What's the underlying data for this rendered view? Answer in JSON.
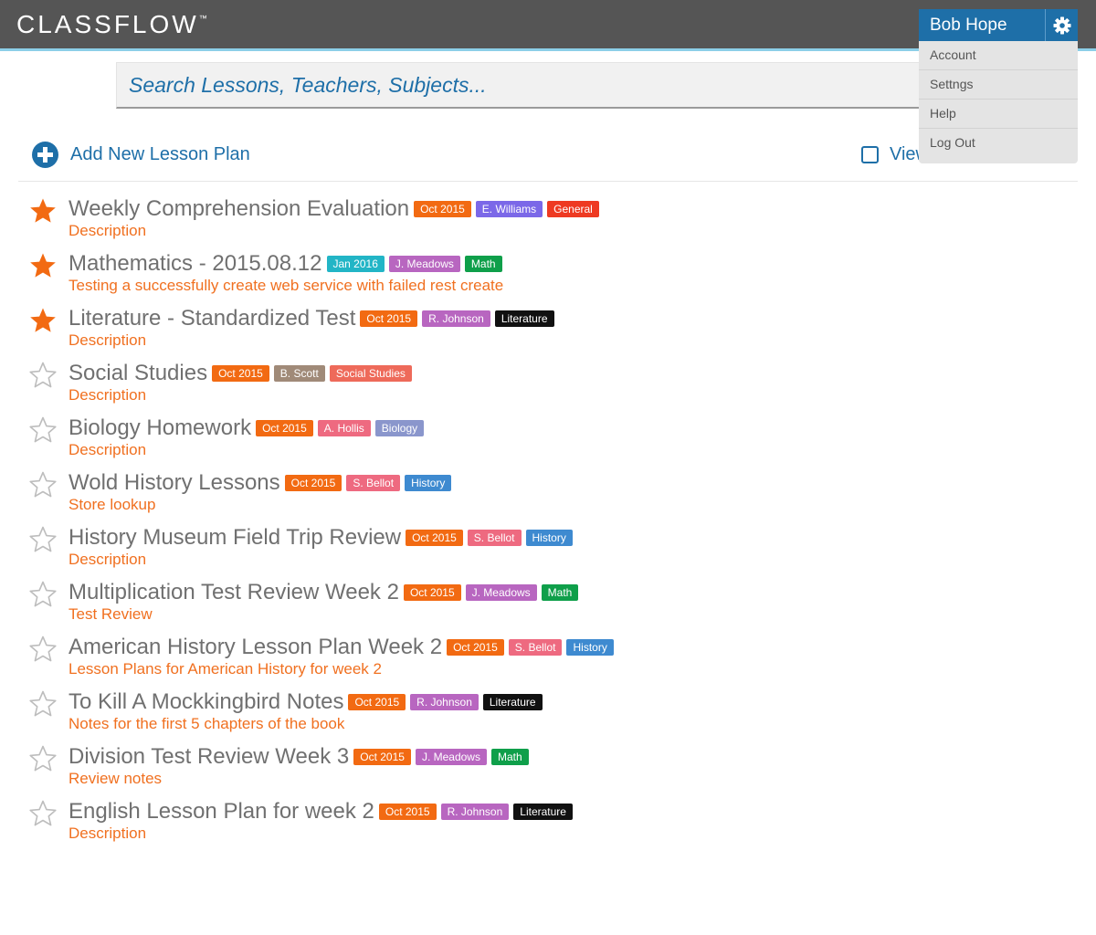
{
  "app": {
    "logo": "CLASSFLOW",
    "logo_mark": "™"
  },
  "user_menu": {
    "name": "Bob Hope",
    "items": [
      "Account",
      "Settngs",
      "Help",
      "Log Out"
    ]
  },
  "search": {
    "placeholder": "Search Lessons, Teachers, Subjects..."
  },
  "toolbar": {
    "add_label": "Add New Lesson Plan",
    "view_label": "View"
  },
  "colors": {
    "brand_blue": "#1e6fa8",
    "star_active": "#f26a12",
    "date_tag": "#f26a12",
    "date_tag_jan": "#22b5c6",
    "teacher_williams": "#7b68e8",
    "teacher_meadows": "#b866c0",
    "teacher_johnson": "#b866c0",
    "teacher_scott": "#a08a78",
    "teacher_hollis": "#ee6a80",
    "teacher_bellot": "#ee6a80",
    "subject_general": "#ee3a22",
    "subject_math": "#0f9f4a",
    "subject_literature": "#111111",
    "subject_social": "#ee6a5a",
    "subject_biology": "#8a96cc",
    "subject_history": "#3e8ad0"
  },
  "lessons": [
    {
      "title": "Weekly Comprehension Evaluation",
      "description": "Description",
      "starred": true,
      "tags": [
        {
          "text": "Oct 2015",
          "color": "#f26a12"
        },
        {
          "text": "E. Williams",
          "color": "#7b68e8"
        },
        {
          "text": "General",
          "color": "#ee3a22"
        }
      ]
    },
    {
      "title": "Mathematics - 2015.08.12",
      "description": "Testing a successfully create web service with failed rest create",
      "starred": true,
      "tags": [
        {
          "text": "Jan 2016",
          "color": "#22b5c6"
        },
        {
          "text": "J. Meadows",
          "color": "#b866c0"
        },
        {
          "text": "Math",
          "color": "#0f9f4a"
        }
      ]
    },
    {
      "title": "Literature - Standardized Test",
      "description": "Description",
      "starred": true,
      "tags": [
        {
          "text": "Oct 2015",
          "color": "#f26a12"
        },
        {
          "text": "R. Johnson",
          "color": "#b866c0"
        },
        {
          "text": "Literature",
          "color": "#111111"
        }
      ]
    },
    {
      "title": "Social Studies",
      "description": "Description",
      "starred": false,
      "tags": [
        {
          "text": "Oct 2015",
          "color": "#f26a12"
        },
        {
          "text": "B. Scott",
          "color": "#a08a78"
        },
        {
          "text": "Social Studies",
          "color": "#ee6a5a"
        }
      ]
    },
    {
      "title": "Biology Homework",
      "description": "Description",
      "starred": false,
      "tags": [
        {
          "text": "Oct 2015",
          "color": "#f26a12"
        },
        {
          "text": "A. Hollis",
          "color": "#ee6a80"
        },
        {
          "text": "Biology",
          "color": "#8a96cc"
        }
      ]
    },
    {
      "title": "Wold History Lessons",
      "description": "Store lookup",
      "starred": false,
      "tags": [
        {
          "text": "Oct 2015",
          "color": "#f26a12"
        },
        {
          "text": "S. Bellot",
          "color": "#ee6a80"
        },
        {
          "text": "History",
          "color": "#3e8ad0"
        }
      ]
    },
    {
      "title": "History Museum Field Trip Review",
      "description": "Description",
      "starred": false,
      "tags": [
        {
          "text": "Oct 2015",
          "color": "#f26a12"
        },
        {
          "text": "S. Bellot",
          "color": "#ee6a80"
        },
        {
          "text": "History",
          "color": "#3e8ad0"
        }
      ]
    },
    {
      "title": "Multiplication Test Review Week 2",
      "description": "Test Review",
      "starred": false,
      "tags": [
        {
          "text": "Oct 2015",
          "color": "#f26a12"
        },
        {
          "text": "J. Meadows",
          "color": "#b866c0"
        },
        {
          "text": "Math",
          "color": "#0f9f4a"
        }
      ]
    },
    {
      "title": "American History Lesson Plan Week 2",
      "description": "Lesson Plans for American History for week 2",
      "starred": false,
      "tags": [
        {
          "text": "Oct 2015",
          "color": "#f26a12"
        },
        {
          "text": "S. Bellot",
          "color": "#ee6a80"
        },
        {
          "text": "History",
          "color": "#3e8ad0"
        }
      ]
    },
    {
      "title": "To Kill A Mockkingbird Notes",
      "description": "Notes for the first 5 chapters of the book",
      "starred": false,
      "tags": [
        {
          "text": "Oct 2015",
          "color": "#f26a12"
        },
        {
          "text": "R. Johnson",
          "color": "#b866c0"
        },
        {
          "text": "Literature",
          "color": "#111111"
        }
      ]
    },
    {
      "title": "Division Test Review Week 3",
      "description": "Review notes",
      "starred": false,
      "tags": [
        {
          "text": "Oct 2015",
          "color": "#f26a12"
        },
        {
          "text": "J. Meadows",
          "color": "#b866c0"
        },
        {
          "text": "Math",
          "color": "#0f9f4a"
        }
      ]
    },
    {
      "title": "English Lesson Plan for week 2",
      "description": "Description",
      "starred": false,
      "tags": [
        {
          "text": "Oct 2015",
          "color": "#f26a12"
        },
        {
          "text": "R. Johnson",
          "color": "#b866c0"
        },
        {
          "text": "Literature",
          "color": "#111111"
        }
      ]
    }
  ]
}
